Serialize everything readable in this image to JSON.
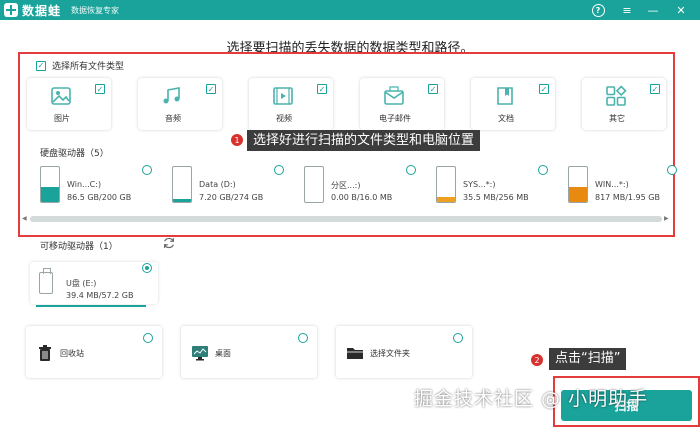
{
  "titlebar": {
    "brand": "数据蛙",
    "subtitle": "数据恢复专家",
    "help_glyph": "?",
    "menu_glyph": "≡",
    "min_glyph": "—",
    "close_glyph": "✕",
    "color": "#1aa39a"
  },
  "main_title": "选择要扫描的丢失数据的数据类型和路径。",
  "select_all": {
    "label": "选择所有文件类型",
    "checked": true
  },
  "check_glyph": "✓",
  "file_types": [
    {
      "label": "图片",
      "icon": "image-icon",
      "checked": true
    },
    {
      "label": "音频",
      "icon": "audio-icon",
      "checked": true
    },
    {
      "label": "视频",
      "icon": "video-icon",
      "checked": true
    },
    {
      "label": "电子邮件",
      "icon": "email-icon",
      "checked": true
    },
    {
      "label": "文档",
      "icon": "document-icon",
      "checked": true
    },
    {
      "label": "其它",
      "icon": "other-icon",
      "checked": true
    }
  ],
  "hard_drives": {
    "title": "硬盘驱动器（5）",
    "items": [
      {
        "name": "Win...C:)",
        "size": "86.5 GB/200 GB",
        "fill": 0.43,
        "color": "#1aa39a"
      },
      {
        "name": "Data (D:)",
        "size": "7.20 GB/274 GB",
        "fill": 0.03,
        "color": "#1aa39a"
      },
      {
        "name": "分区...:)",
        "size": "0.00  B/16.0 MB",
        "fill": 0.0,
        "color": "#1aa39a"
      },
      {
        "name": "SYS...*:)",
        "size": "35.5 MB/256 MB",
        "fill": 0.14,
        "color": "#f0a020"
      },
      {
        "name": "WIN...*:)",
        "size": "817 MB/1.95 GB",
        "fill": 0.42,
        "color": "#e88a10"
      }
    ]
  },
  "scroll": {
    "left_glyph": "◀",
    "right_glyph": "▶"
  },
  "callouts": {
    "step1": {
      "number": "1",
      "text": "选择好进行扫描的文件类型和电脑位置"
    },
    "step2": {
      "number": "2",
      "text": "点击“扫描”"
    }
  },
  "removable": {
    "title": "可移动驱动器（1）",
    "refresh_icon": "refresh-icon",
    "item": {
      "name": "U盘 (E:)",
      "size": "39.4 MB/57.2 GB",
      "selected": true
    }
  },
  "locations": [
    {
      "label": "回收站",
      "icon": "recycle-bin-icon"
    },
    {
      "label": "桌面",
      "icon": "desktop-icon"
    },
    {
      "label": "选择文件夹",
      "icon": "folder-icon"
    }
  ],
  "scan_button": "扫描",
  "watermark": "掘金技术社区 @ 小明助手",
  "accent_color": "#1aa39a",
  "highlight_color": "#e23c3c"
}
